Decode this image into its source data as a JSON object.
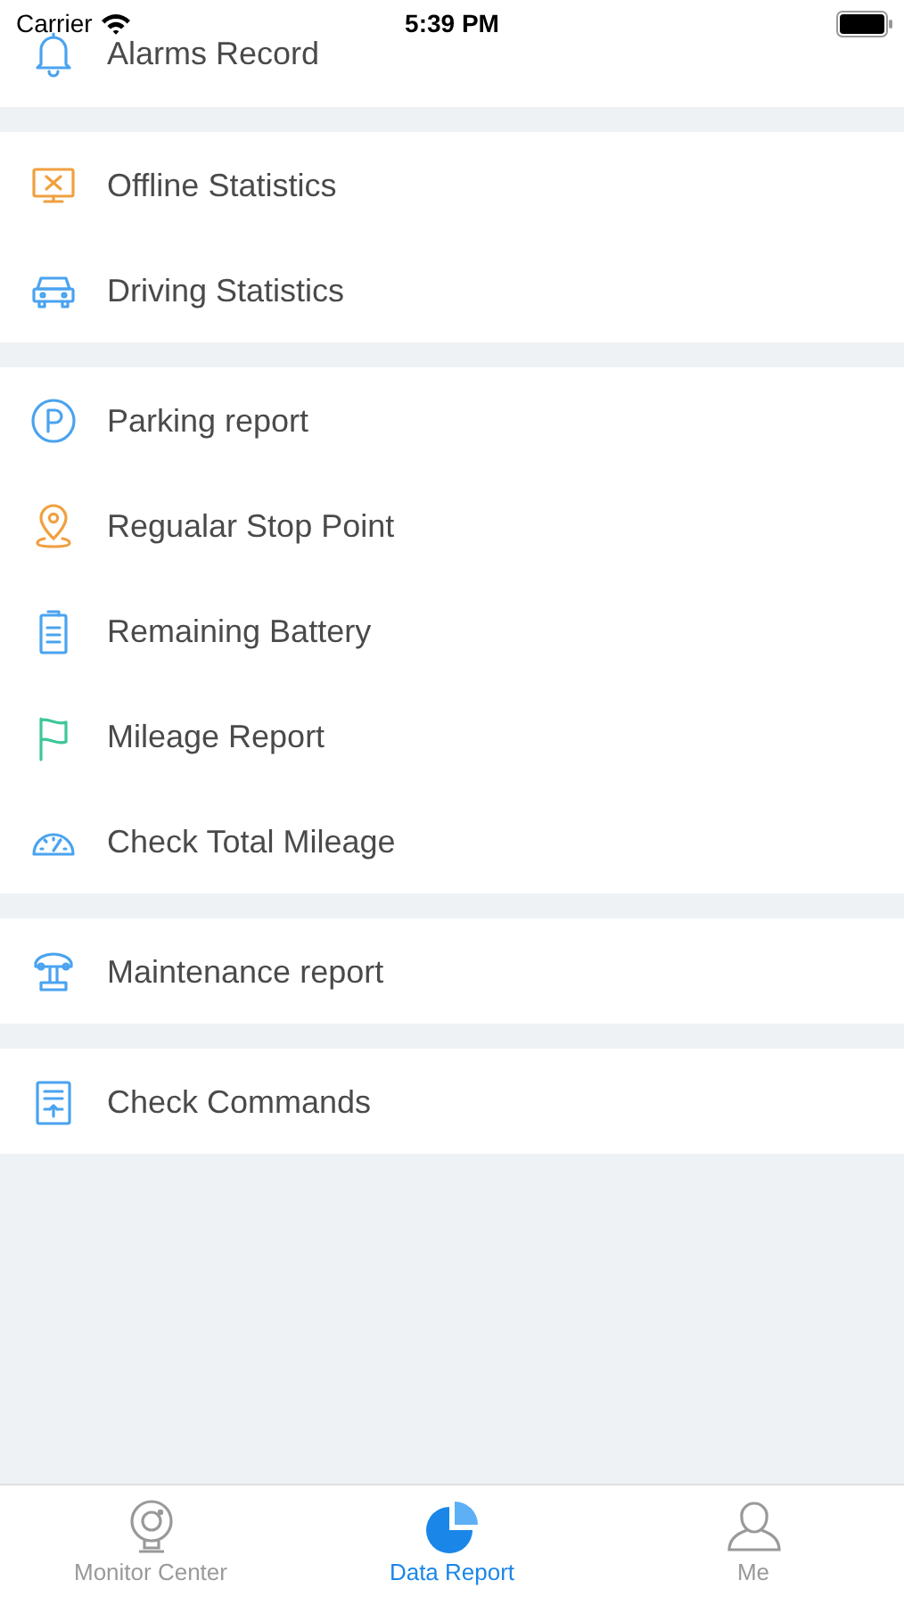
{
  "status_bar": {
    "carrier": "Carrier",
    "time": "5:39 PM"
  },
  "sections": [
    {
      "items": [
        {
          "label": "Alarms Record"
        }
      ]
    },
    {
      "items": [
        {
          "label": "Offline Statistics"
        },
        {
          "label": "Driving Statistics"
        }
      ]
    },
    {
      "items": [
        {
          "label": "Parking report"
        },
        {
          "label": "Regualar Stop Point"
        },
        {
          "label": "Remaining Battery"
        },
        {
          "label": "Mileage Report"
        },
        {
          "label": "Check Total Mileage"
        }
      ]
    },
    {
      "items": [
        {
          "label": "Maintenance report"
        }
      ]
    },
    {
      "items": [
        {
          "label": "Check Commands"
        }
      ]
    }
  ],
  "tab_bar": [
    {
      "label": "Monitor Center",
      "selected": false
    },
    {
      "label": "Data Report",
      "selected": true
    },
    {
      "label": "Me",
      "selected": false
    }
  ]
}
